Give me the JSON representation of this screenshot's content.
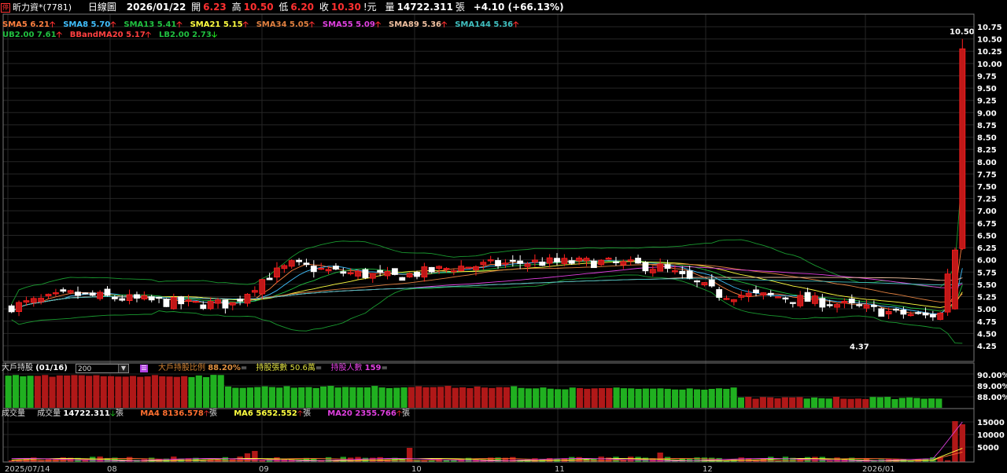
{
  "header": {
    "stock_name": "昕力資*(7781)",
    "stock_icon": "停",
    "chart_type": "日線圖",
    "date": "2026/01/22",
    "open_label": "開",
    "open": "6.23",
    "high_label": "高",
    "high": "10.50",
    "low_label": "低",
    "low": "6.20",
    "close_label": "收",
    "close": "10.30",
    "close_suffix": "!元",
    "volume_label": "量",
    "volume": "14722.311",
    "volume_unit": "張",
    "change": "+4.10 (+66.13%)"
  },
  "indicators_row1": [
    {
      "text": "SMA5 6.21",
      "color": "#ff8040"
    },
    {
      "text": "SMA8 5.70",
      "color": "#40c0ff"
    },
    {
      "text": "SMA13 5.41",
      "color": "#20c040"
    },
    {
      "text": "SMA21 5.15",
      "color": "#ffff40"
    },
    {
      "text": "SMA34 5.05",
      "color": "#e08040"
    },
    {
      "text": "SMA55 5.09",
      "color": "#e040e0"
    },
    {
      "text": "SMA89 5.36",
      "color": "#f0c0a0"
    },
    {
      "text": "SMA144 5.36",
      "color": "#40c0c0"
    }
  ],
  "indicators_row2": [
    {
      "text": "UB2.00 7.61",
      "color": "#20c040",
      "arrow": "up"
    },
    {
      "text": "BBandMA20 5.17",
      "color": "#ff4040",
      "arrow": "up"
    },
    {
      "text": "LB2.00 2.73",
      "color": "#20c040",
      "arrow": "down"
    }
  ],
  "price_axis": [
    "10.75",
    "10.50",
    "10.25",
    "10.00",
    "9.75",
    "9.50",
    "9.25",
    "9.00",
    "8.75",
    "8.50",
    "8.25",
    "8.00",
    "7.75",
    "7.50",
    "7.25",
    "7.00",
    "6.75",
    "6.50",
    "6.25",
    "6.00",
    "5.75",
    "5.50",
    "5.25",
    "5.00",
    "4.75",
    "4.50",
    "4.25"
  ],
  "price_annotations": {
    "high": "10.50",
    "low": "4.37"
  },
  "holder_panel": {
    "title": "大戶持股",
    "period": "(01/16)",
    "select_value": "200",
    "ratio_label": "大戶持股比例",
    "ratio_value": "88.20%",
    "shares_label": "持股張數",
    "shares_value": "50.6萬",
    "people_label": "持股人數",
    "people_value": "159",
    "eq": "=",
    "axis": [
      "90.00%",
      "89.00%",
      "88.00%"
    ]
  },
  "volume_panel": {
    "title": "成交量",
    "vol_label": "成交量",
    "vol_value": "14722.311",
    "ma4": "MA4 8136.578",
    "ma6": "MA6 5652.552",
    "ma20": "MA20 2355.766",
    "unit": "張",
    "axis": [
      "15000",
      "10000",
      "5000"
    ]
  },
  "x_axis": [
    "2025/07/14",
    "08",
    "09",
    "10",
    "11",
    "12",
    "2026/01"
  ],
  "colors": {
    "up": "#ff2020",
    "down": "#ffffff",
    "holder_up": "#20b020",
    "holder_down": "#b01818"
  }
}
